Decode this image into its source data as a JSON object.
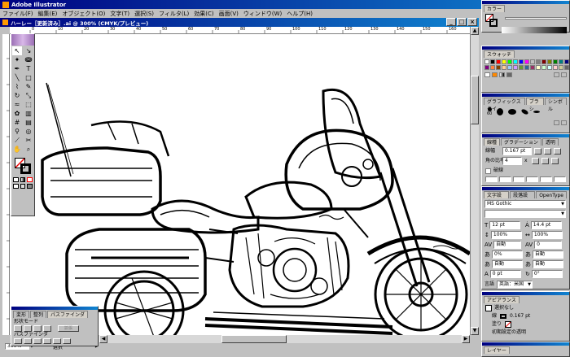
{
  "app": {
    "title": "Adobe Illustrator"
  },
  "menu": [
    "ファイル(F)",
    "編集(E)",
    "オブジェクト(O)",
    "文字(T)",
    "選択(S)",
    "フィルタ(L)",
    "効果(C)",
    "画面(V)",
    "ウィンドウ(W)",
    "ヘルプ(H)"
  ],
  "document": {
    "title": "ハーレー［更新済み］.ai @ 300% (CMYK/プレビュー)"
  },
  "ruler": {
    "ticks": [
      "0",
      "10",
      "20",
      "30",
      "40",
      "50",
      "60",
      "70",
      "80",
      "90",
      "100",
      "110",
      "120",
      "130",
      "140",
      "150",
      "160"
    ]
  },
  "status": {
    "zoom": "300%",
    "tool": "選択"
  },
  "color_panel": {
    "title": "カラー"
  },
  "swatches_panel": {
    "title": "スウォッチ",
    "colors": [
      "#ffffff",
      "#000000",
      "#ff0000",
      "#ffff00",
      "#00ff00",
      "#00ffff",
      "#0000ff",
      "#ff00ff",
      "#c0c0c0",
      "#808080",
      "#800000",
      "#808000",
      "#008000",
      "#008080",
      "#000080",
      "#800080",
      "#ff8040",
      "#804000",
      "#ffcc99",
      "#99ccff",
      "#cc99ff",
      "#669933",
      "#336699",
      "#993366",
      "#ffffcc",
      "#ccffcc",
      "#ccffff",
      "#ffcccc",
      "#cccc99",
      "#666666"
    ]
  },
  "brush_panel": {
    "tabs": [
      "グラフィックスタイ",
      "ブラシ",
      "シンボル"
    ],
    "size_label": "60"
  },
  "stroke_panel": {
    "tabs": [
      "線種",
      "グラデーション",
      "透明"
    ],
    "weight_label": "線幅",
    "weight_value": "0.167 pt",
    "miter_label": "角の比率",
    "miter_value": "4",
    "x_label": "x",
    "dash_label": "破線"
  },
  "type_panel": {
    "tabs": [
      "文字設定",
      "段落設定",
      "OpenType"
    ],
    "font": "MS Gothic",
    "style": "",
    "size": "12 pt",
    "leading": "14.4 pt",
    "hscale": "100%",
    "vscale": "100%",
    "kerning": "自動",
    "tracking": "0",
    "baseline_auto": "自動",
    "shift": "0 pt",
    "rotation": "0°",
    "lang_label": "言語",
    "lang": "英語：米国",
    "rows": [
      {
        "a": "12 pt",
        "b": "14.4 pt"
      },
      {
        "a": "100%",
        "b": "100%"
      },
      {
        "a": "自動",
        "b": "0"
      },
      {
        "a": "0%",
        "b": "自動"
      },
      {
        "a": "自動",
        "b": "自動"
      },
      {
        "a": "0 pt",
        "b": "0°"
      }
    ]
  },
  "appearance_panel": {
    "title": "アピアランス",
    "item": "選択なし",
    "stroke_label": "線",
    "stroke_value": "0.167 pt",
    "fill_label": "塗り",
    "opacity": "初期設定の透明"
  },
  "layer_panel": {
    "title": "レイヤー"
  },
  "pathfinder_panel": {
    "tabs": [
      "変形",
      "整列",
      "パスファインダ"
    ],
    "shape_mode_label": "形状モード",
    "pathfinder_label": "パスファインダ",
    "expand_label": "拡張"
  }
}
